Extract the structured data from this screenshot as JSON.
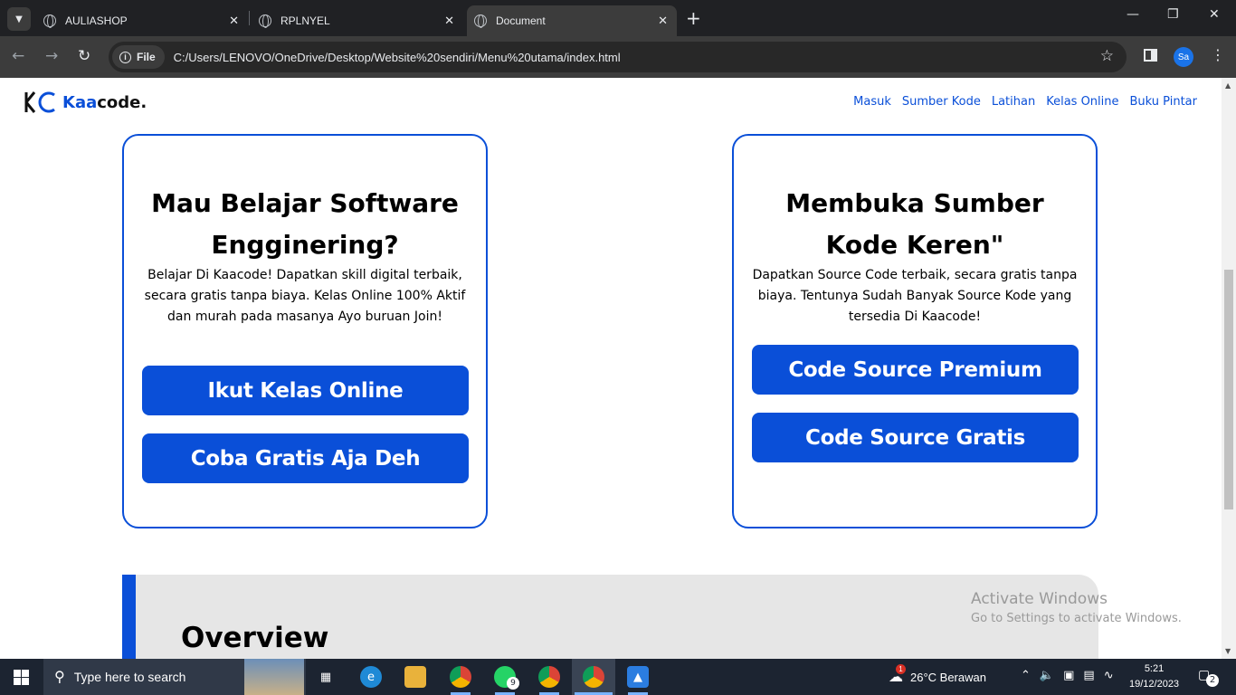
{
  "browser": {
    "tabs": [
      {
        "title": "AULIASHOP",
        "active": false
      },
      {
        "title": "RPLNYEL",
        "active": false
      },
      {
        "title": "Document",
        "active": true
      }
    ],
    "file_chip": "File",
    "url": "C:/Users/LENOVO/OneDrive/Desktop/Website%20sendiri/Menu%20utama/index.html",
    "profile_initials": "Sa"
  },
  "site": {
    "logo_part1": "Kaa",
    "logo_part2": "code.",
    "nav": [
      "Masuk",
      "Sumber Kode",
      "Latihan",
      "Kelas Online",
      "Buku Pintar"
    ]
  },
  "cards": [
    {
      "title_line1": "Mau Belajar Software",
      "title_line2": "Engginering?",
      "description": "Belajar Di Kaacode! Dapatkan skill digital terbaik, secara gratis tanpa biaya. Kelas Online 100% Aktif dan murah pada masanya Ayo buruan Join!",
      "buttons": [
        "Ikut Kelas Online",
        "Coba Gratis Aja Deh"
      ]
    },
    {
      "title_line1": "Membuka Sumber",
      "title_line2": "Kode Keren\"",
      "description": "Dapatkan Source Code terbaik, secara gratis tanpa biaya. Tentunya Sudah Banyak Source Kode yang tersedia Di Kaacode!",
      "buttons": [
        "Code Source Premium",
        "Code Source Gratis"
      ]
    }
  ],
  "overview": {
    "title": "Overview"
  },
  "activate_windows": {
    "line1": "Activate Windows",
    "line2": "Go to Settings to activate Windows."
  },
  "taskbar": {
    "search_placeholder": "Type here to search",
    "whatsapp_badge": "9",
    "weather_badge": "1",
    "weather": "26°C  Berawan",
    "time": "5:21",
    "date": "19/12/2023",
    "notifications": "2"
  },
  "colors": {
    "brand": "#0a4fd8",
    "taskbar": "#1c2431"
  }
}
